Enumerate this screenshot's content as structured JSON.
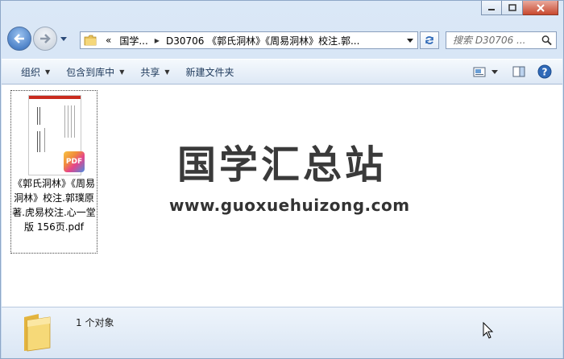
{
  "window": {
    "controls": {
      "minimize": "minimize",
      "maximize": "maximize",
      "close": "close"
    }
  },
  "address": {
    "overflow": "«",
    "parts": [
      "国学...",
      "D30706 《郭氏洞林》《周易洞林》校注.郭..."
    ]
  },
  "search": {
    "placeholder": "搜索 D30706 ..."
  },
  "toolbar": {
    "organize": "组织",
    "include_in_library": "包含到库中",
    "share": "共享",
    "new_folder": "新建文件夹"
  },
  "file": {
    "name": "《郭氏洞林》《周易洞林》校注.郭璞原著.虎易校注.心一堂版 156页.pdf",
    "badge": "PDF"
  },
  "watermark": {
    "title": "国学汇总站",
    "url": "www.guoxuehuizong.com"
  },
  "details": {
    "count": "1 个对象"
  },
  "colors": {
    "accent": "#2f69b8",
    "close": "#c8492f",
    "pdf_top": "#c92b1f"
  }
}
